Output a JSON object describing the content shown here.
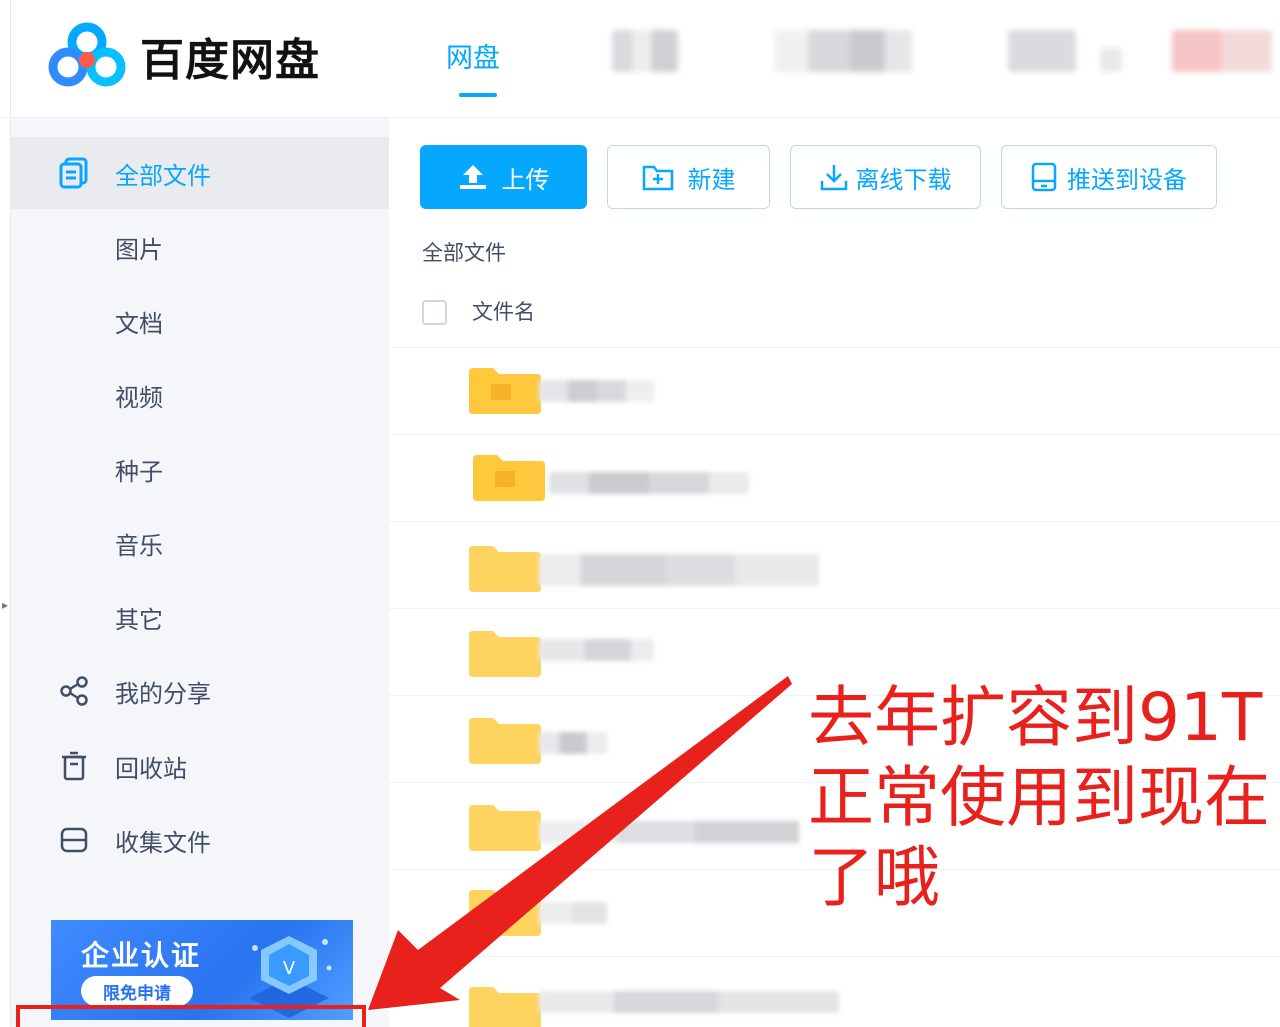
{
  "header": {
    "brand": "百度网盘",
    "nav_active": "网盘"
  },
  "sidebar": {
    "items": [
      {
        "label": "全部文件",
        "icon": "files-icon"
      },
      {
        "label": "图片"
      },
      {
        "label": "文档"
      },
      {
        "label": "视频"
      },
      {
        "label": "种子"
      },
      {
        "label": "音乐"
      },
      {
        "label": "其它"
      },
      {
        "label": "我的分享",
        "icon": "share-icon"
      },
      {
        "label": "回收站",
        "icon": "trash-icon"
      },
      {
        "label": "收集文件",
        "icon": "collect-icon"
      }
    ],
    "promo": {
      "title": "企业认证",
      "button": "限免申请"
    }
  },
  "toolbar": {
    "upload": "上传",
    "new": "新建",
    "offline_download": "离线下载",
    "push_device": "推送到设备"
  },
  "main": {
    "breadcrumb": "全部文件",
    "column_name": "文件名"
  },
  "annotation": {
    "line1": "去年扩容到91T",
    "line2": "正常使用到现在",
    "line3": "了哦"
  },
  "colors": {
    "accent": "#06a7ff",
    "annotation_red": "#e8211d",
    "folder_yellow": "#ffc83d"
  }
}
